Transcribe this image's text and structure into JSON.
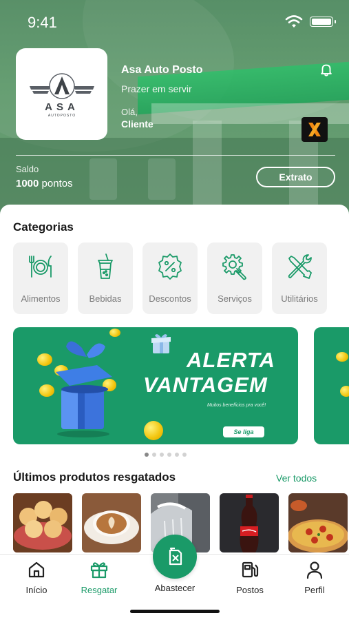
{
  "status_bar": {
    "time": "9:41"
  },
  "header": {
    "logo_text": "ASA",
    "logo_subtext": "AUTOPOSTO",
    "station_name": "Asa Auto Posto",
    "slogan": "Prazer em servir",
    "greeting": "Olá,",
    "user_name": "Cliente",
    "partner_badge": "X",
    "balance_label": "Saldo",
    "balance_value": "1000",
    "balance_unit": "pontos",
    "statement_button": "Extrato"
  },
  "categories": {
    "title": "Categorias",
    "items": [
      {
        "label": "Alimentos",
        "icon": "cutlery-plate-icon"
      },
      {
        "label": "Bebidas",
        "icon": "drink-cup-icon"
      },
      {
        "label": "Descontos",
        "icon": "discount-badge-icon"
      },
      {
        "label": "Serviços",
        "icon": "gear-wrench-icon"
      },
      {
        "label": "Utilitários",
        "icon": "tools-icon"
      }
    ]
  },
  "banner": {
    "line1": "ALERTA",
    "line2": "VANTAGEM",
    "subtitle": "Muitos benefícios pra você!",
    "cta": "Se liga",
    "page_count": 6,
    "active_page": 1
  },
  "recent": {
    "title": "Últimos produtos resgatados",
    "see_all": "Ver todos",
    "items": [
      {
        "name": "pao-de-queijo",
        "icon": "cheese-bread-image"
      },
      {
        "name": "cafe",
        "icon": "coffee-cup-image"
      },
      {
        "name": "lavagem",
        "icon": "car-wash-image"
      },
      {
        "name": "refrigerante",
        "icon": "cola-bottle-image"
      },
      {
        "name": "pizza",
        "icon": "pizza-image"
      }
    ]
  },
  "nav": {
    "home": "Início",
    "redeem": "Resgatar",
    "refuel": "Abastecer",
    "stations": "Postos",
    "profile": "Perfil"
  },
  "colors": {
    "accent": "#1a9a68",
    "header_bg": "#5f9a6c",
    "card_bg": "#f1f1f1",
    "coin": "#f2c40c"
  }
}
